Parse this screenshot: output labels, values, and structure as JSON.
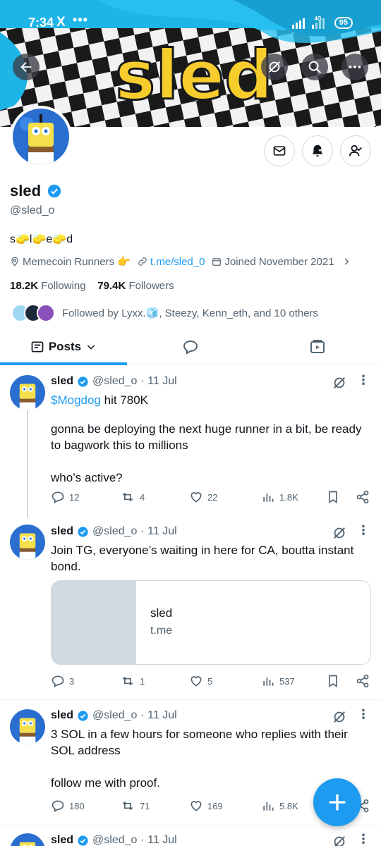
{
  "status_bar": {
    "time": "7:34",
    "app_icon": "X",
    "dots": "•••",
    "network": "4G",
    "battery": "95"
  },
  "banner": {
    "text": "sled"
  },
  "header_buttons": [
    "back-arrow-icon",
    "grok-icon",
    "search-icon",
    "more-icon"
  ],
  "profile": {
    "name": "sled",
    "handle": "@sled_o",
    "bio": "s🧽l🧽e🧽d",
    "location": "Memecoin Runners 👉",
    "link": "t.me/sled_0",
    "joined": "Joined November 2021",
    "following_count": "18.2K",
    "following_label": "Following",
    "followers_count": "79.4K",
    "followers_label": "Followers",
    "followed_by": "Followed by Lyxx.🧊, Steezy, Kenn_eth, and 10 others"
  },
  "tabs": {
    "posts_label": "Posts"
  },
  "tweets": [
    {
      "name": "sled",
      "handle": "@sled_o",
      "date": "· 11 Jul",
      "cashtag": "$Mogdog",
      "text_after_cashtag": " hit 780K",
      "text": "gonna be deploying the next huge runner in a bit, be ready to bagwork this to millions\n\nwho’s active?",
      "replies": "12",
      "reposts": "4",
      "likes": "22",
      "views": "1.8K"
    },
    {
      "name": "sled",
      "handle": "@sled_o",
      "date": "· 11 Jul",
      "text": "Join TG, everyone’s waiting in here for CA, boutta instant bond.",
      "card_title": "sled",
      "card_domain": "t.me",
      "replies": "3",
      "reposts": "1",
      "likes": "5",
      "views": "537"
    },
    {
      "name": "sled",
      "handle": "@sled_o",
      "date": "· 11 Jul",
      "text": "3 SOL in a few hours for someone who replies with their SOL address\n\nfollow me with proof.",
      "replies": "180",
      "reposts": "71",
      "likes": "169",
      "views": "5.8K"
    },
    {
      "name": "sled",
      "handle": "@sled_o",
      "date": "· 11 Jul"
    }
  ],
  "colors": {
    "accent": "#1d9bf0",
    "banner_blue": "#1fb4e6",
    "banner_text": "#f7cd2e"
  }
}
